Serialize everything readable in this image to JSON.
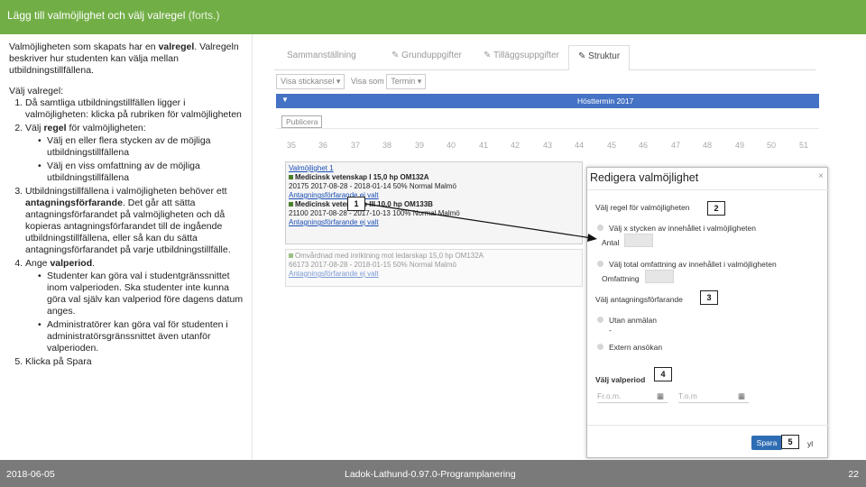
{
  "header": {
    "title": "Lägg till valmöjlighet och välj valregel",
    "suffix": "(forts.)",
    "bg_color": "#72ae46"
  },
  "left": {
    "intro_1": "Valmöjligheten som skapats har en ",
    "intro_bold": "valregel",
    "intro_2": ". Valregeln beskriver hur studenten kan välja mellan utbildningstillfällena.",
    "heading": "Välj valregel:",
    "step1": "Då samtliga utbildningstillfällen ligger i valmöjligheten: klicka på rubriken för valmöjligheten",
    "step2_pre": "Välj ",
    "step2_bold": "regel",
    "step2_post": " för valmöjligheten:",
    "step2_b1": "Välj en eller flera stycken av de möjliga utbildningstillfällena",
    "step2_b2": "Välj en viss omfattning av de möjliga utbildningstillfällena",
    "step3_pre": "Utbildningstillfällena i valmöjligheten behöver ett ",
    "step3_bold": "antagningsförfarande",
    "step3_post": ". Det går att sätta antagningsförfarandet på valmöjligheten och då kopieras antagningsförfarandet till de ingående utbildningstillfällena, eller så kan du sätta antagningsförfarandet på varje utbildningstillfälle.",
    "step4_pre": "Ange ",
    "step4_bold": "valperiod",
    "step4_post": ".",
    "step4_b1": "Studenter kan göra val i studentgränssnittet inom valperioden. Ska studenter inte kunna göra val själv kan valperiod före dagens datum anges.",
    "step4_b2": "Administratörer kan göra val för studenten i administratörsgränssnittet även utanför valperioden.",
    "step5": "Klicka på Spara"
  },
  "footer": {
    "date": "2018-06-05",
    "center": "Ladok-Lathund-0.97.0-Programplanering",
    "page": "22"
  },
  "shot": {
    "tabs": [
      "Sammanställning",
      "Grunduppgifter",
      "Tilläggsuppgifter",
      "Struktur"
    ],
    "filter_1": "Visa stickansel ▾",
    "filter_2_label": "Visa som",
    "filter_2": "Termin ▾",
    "term_label": "Hösttermin 2017",
    "publish": "Publicera",
    "weeks": [
      "35",
      "36",
      "37",
      "38",
      "39",
      "40",
      "41",
      "42",
      "43",
      "44",
      "45",
      "46",
      "47",
      "48",
      "49",
      "50",
      "51"
    ],
    "vm_title": "Valmöjlighet 1",
    "vm_course1": "Medicinsk vetenskap I 15,0 hp OM132A",
    "vm_course1_detail": "20175 2017-08-28 - 2018-01-14 50% Normal Malmö",
    "vm_course1_link": "Antagningsförfarande ej valt",
    "vm_course2": "Medicinsk vetenskap III 10,0 hp OM133B",
    "vm_course2_detail": "21100 2017-08-28 - 2017-10-13 100% Normal Malmö",
    "vm_course2_link": "Antagningsförfarande ej valt",
    "vm3_course": "Omvårdnad med inriktning mot ledarskap 15,0 hp OM132A",
    "vm3_detail": "66173 2017-08-28 - 2018-01-15 50% Normal Malmö",
    "vm3_link": "Antagningsförfarande ej valt"
  },
  "modal": {
    "title": "Redigera valmöjlighet",
    "close": "×",
    "rule_heading": "Välj regel för valmöjligheten",
    "rule_opt1": "Välj x stycken av innehållet i valmöjligheten",
    "count_label": "Antal",
    "rule_opt2": "Välj total omfattning av innehållet i valmöjligheten",
    "scope_label": "Omfattning",
    "admission_heading": "Välj antagningsförfarande",
    "admission_opt1": "Utan anmälan",
    "admission_dash": "-",
    "admission_opt2": "Extern ansökan",
    "period_heading": "Välj valperiod",
    "from_placeholder": "Fr.o.m.",
    "to_placeholder": "T.o.m",
    "save": "Spara",
    "cancel_partial": "yl"
  },
  "markers": {
    "m1": "1",
    "m2": "2",
    "m3": "3",
    "m4": "4",
    "m5": "5"
  }
}
